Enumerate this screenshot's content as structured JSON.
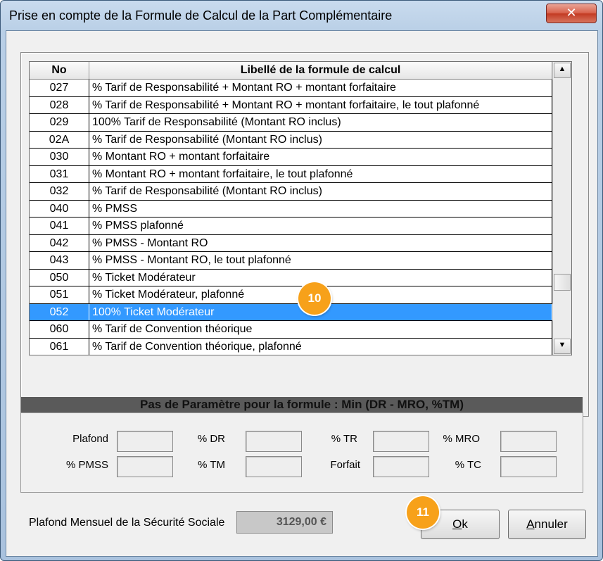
{
  "window": {
    "title": "Prise en compte de la Formule de Calcul de la Part Complémentaire",
    "close_glyph": "✕"
  },
  "grid": {
    "headers": {
      "no": "No",
      "libelle": "Libellé de la formule de calcul"
    },
    "rows": [
      {
        "no": "027",
        "libelle": "% Tarif de Responsabilité + Montant RO + montant forfaitaire"
      },
      {
        "no": "028",
        "libelle": "% Tarif de Responsabilité + Montant RO + montant forfaitaire, le tout plafonné"
      },
      {
        "no": "029",
        "libelle": "100% Tarif de Responsabilité (Montant RO inclus)"
      },
      {
        "no": "02A",
        "libelle": "% Tarif de Responsabilité (Montant RO inclus)"
      },
      {
        "no": "030",
        "libelle": "% Montant RO + montant forfaitaire"
      },
      {
        "no": "031",
        "libelle": "% Montant RO + montant forfaitaire, le tout plafonné"
      },
      {
        "no": "032",
        "libelle": "% Tarif de Responsabilité (Montant RO inclus)"
      },
      {
        "no": "040",
        "libelle": "% PMSS"
      },
      {
        "no": "041",
        "libelle": "% PMSS plafonné"
      },
      {
        "no": "042",
        "libelle": "% PMSS - Montant RO"
      },
      {
        "no": "043",
        "libelle": "% PMSS - Montant RO, le tout plafonné"
      },
      {
        "no": "050",
        "libelle": "% Ticket Modérateur"
      },
      {
        "no": "051",
        "libelle": "% Ticket Modérateur, plafonné"
      },
      {
        "no": "052",
        "libelle": "100% Ticket Modérateur",
        "selected": true
      },
      {
        "no": "060",
        "libelle": "% Tarif de Convention théorique"
      },
      {
        "no": "061",
        "libelle": "% Tarif de Convention théorique, plafonné"
      }
    ],
    "scroll_up_glyph": "▲",
    "scroll_down_glyph": "▼"
  },
  "params": {
    "title": "Pas de Paramètre pour la formule : Min (DR - MRO, %TM)",
    "labels": {
      "plafond": "Plafond",
      "pmss": "% PMSS",
      "dr": "% DR",
      "tm": "% TM",
      "tr": "% TR",
      "forfait": "Forfait",
      "mro": "% MRO",
      "tc": "% TC"
    }
  },
  "footer": {
    "pmss_label": "Plafond Mensuel de la Sécurité Sociale",
    "pmss_value": "3129,00 €",
    "ok_accel": "O",
    "ok_rest": "k",
    "cancel_accel": "A",
    "cancel_rest": "nnuler"
  },
  "annotations": {
    "badge_10": "10",
    "badge_11": "11"
  },
  "colors": {
    "selection": "#3399ff",
    "badge": "#f7a11a",
    "param_title_bg": "#5a5a5a"
  }
}
